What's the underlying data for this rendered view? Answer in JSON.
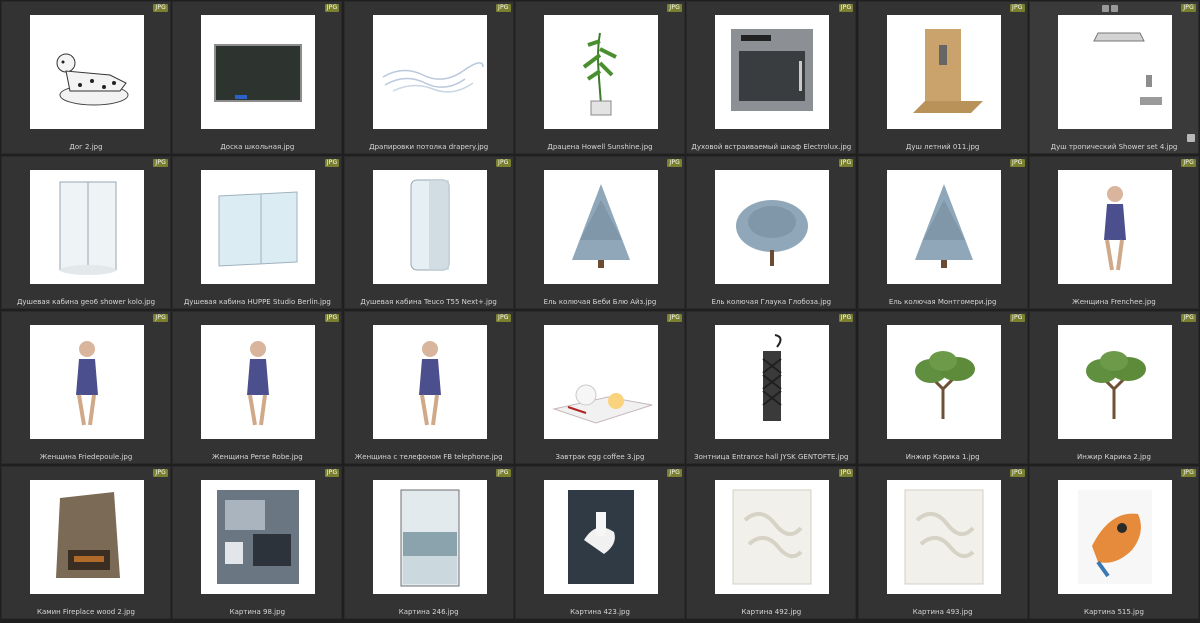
{
  "items": [
    {
      "name": "Дог 2.jpg",
      "badge": "JPG",
      "icon": "dalmatian-dog"
    },
    {
      "name": "Доска школьная.jpg",
      "badge": "JPG",
      "icon": "chalkboard"
    },
    {
      "name": "Драпировки потолка drapery.jpg",
      "badge": "JPG",
      "icon": "ceiling-drapery"
    },
    {
      "name": "Драцена Howell Sunshine.jpg",
      "badge": "JPG",
      "icon": "potted-plant"
    },
    {
      "name": "Духовой встраиваемый шкаф Electrolux.jpg",
      "badge": "JPG",
      "icon": "built-in-oven"
    },
    {
      "name": "Душ летний 011.jpg",
      "badge": "JPG",
      "icon": "summer-shower"
    },
    {
      "name": "Душ тропический Shower set 4.jpg",
      "badge": "JPG",
      "icon": "tropical-shower-set"
    },
    {
      "name": "Душевая кабина geo6 shower kolo.jpg",
      "badge": "JPG",
      "icon": "shower-cabin"
    },
    {
      "name": "Душевая кабина HUPPE Studio Berlin.jpg",
      "badge": "JPG",
      "icon": "glass-shower-enclosure"
    },
    {
      "name": "Душевая кабина Teuco T55 Next+.jpg",
      "badge": "JPG",
      "icon": "round-shower-cabin"
    },
    {
      "name": "Ель колючая Беби Блю Айз.jpg",
      "badge": "JPG",
      "icon": "blue-spruce-tree"
    },
    {
      "name": "Ель колючая Глаука Глобоза.jpg",
      "badge": "JPG",
      "icon": "blue-globe-spruce"
    },
    {
      "name": "Ель колючая Монтгомери.jpg",
      "badge": "JPG",
      "icon": "blue-spruce-tree"
    },
    {
      "name": "Женщина Frenchee.jpg",
      "badge": "JPG",
      "icon": "woman-figure"
    },
    {
      "name": "Женщина Friedepoule.jpg",
      "badge": "JPG",
      "icon": "woman-figure"
    },
    {
      "name": "Женщина Perse Robe.jpg",
      "badge": "JPG",
      "icon": "woman-figure"
    },
    {
      "name": "Женщина с телефоном FB telephone.jpg",
      "badge": "JPG",
      "icon": "woman-figure"
    },
    {
      "name": "Завтрак egg coffee 3.jpg",
      "badge": "JPG",
      "icon": "breakfast-table"
    },
    {
      "name": "Зонтница Entrance hall JYSK GENTOFTE.jpg",
      "badge": "JPG",
      "icon": "umbrella-stand"
    },
    {
      "name": "Инжир Карика 1.jpg",
      "badge": "JPG",
      "icon": "fig-tree"
    },
    {
      "name": "Инжир Карика 2.jpg",
      "badge": "JPG",
      "icon": "fig-tree"
    },
    {
      "name": "Камин Fireplace wood 2.jpg",
      "badge": "JPG",
      "icon": "wood-fireplace"
    },
    {
      "name": "Картина 98.jpg",
      "badge": "JPG",
      "icon": "abstract-painting"
    },
    {
      "name": "Картина 246.jpg",
      "badge": "JPG",
      "icon": "landscape-painting"
    },
    {
      "name": "Картина 423.jpg",
      "badge": "JPG",
      "icon": "horse-painting"
    },
    {
      "name": "Картина 492.jpg",
      "badge": "JPG",
      "icon": "white-relief-art"
    },
    {
      "name": "Картина 493.jpg",
      "badge": "JPG",
      "icon": "white-relief-art"
    },
    {
      "name": "Картина 515.jpg",
      "badge": "JPG",
      "icon": "eagle-painting"
    }
  ]
}
